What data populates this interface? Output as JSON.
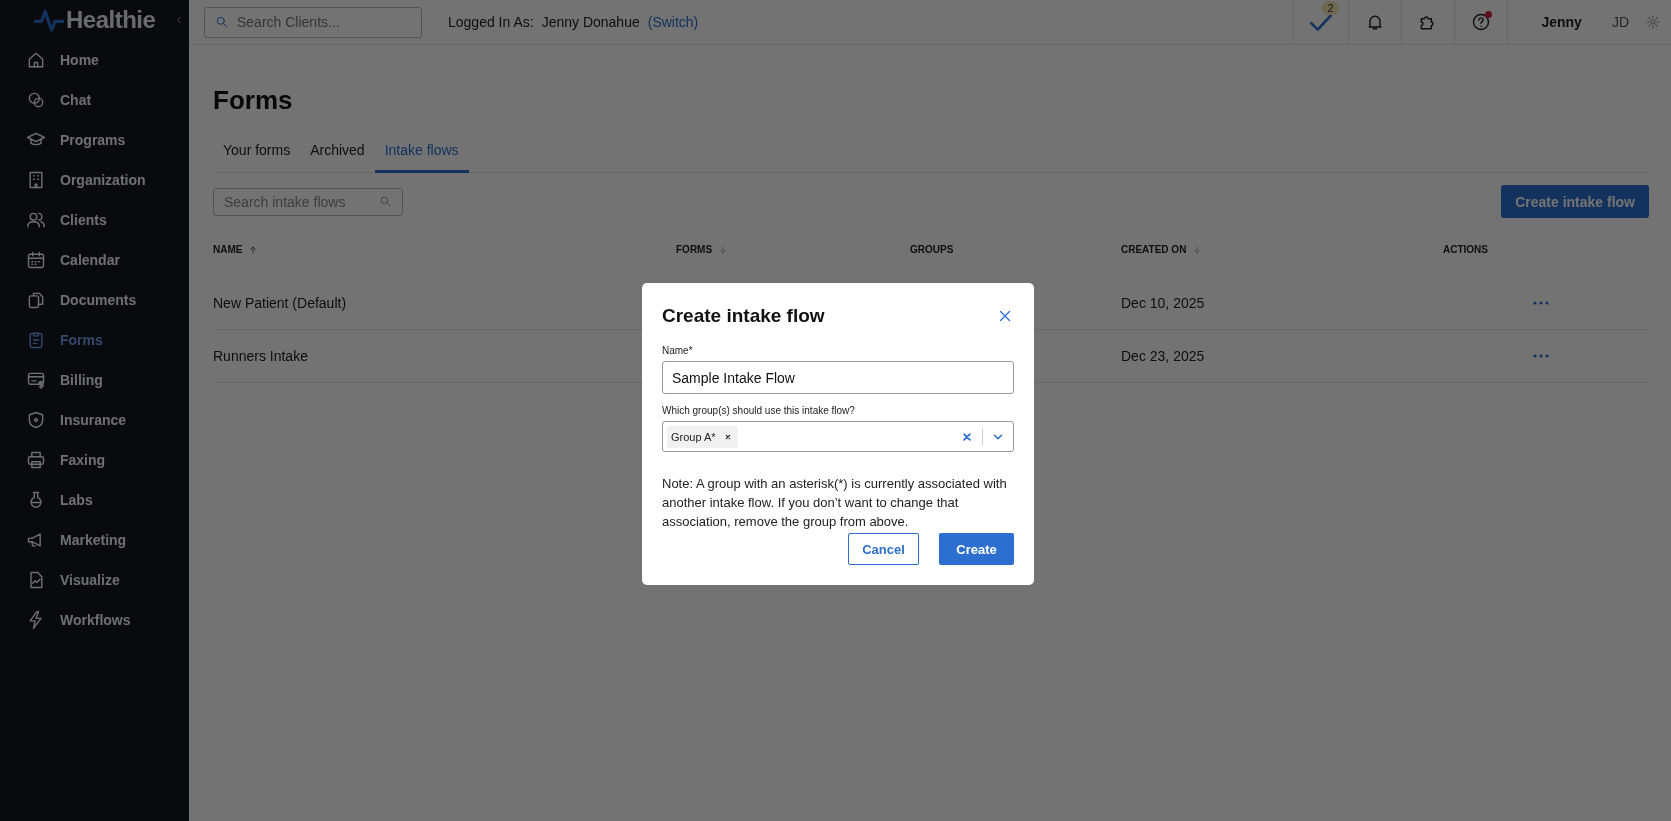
{
  "sidebar": {
    "logo": "Healthie",
    "items": [
      {
        "label": "Home",
        "selected": false
      },
      {
        "label": "Chat",
        "selected": false
      },
      {
        "label": "Programs",
        "selected": false
      },
      {
        "label": "Organization",
        "selected": false
      },
      {
        "label": "Clients",
        "selected": false
      },
      {
        "label": "Calendar",
        "selected": false
      },
      {
        "label": "Documents",
        "selected": false
      },
      {
        "label": "Forms",
        "selected": true
      },
      {
        "label": "Billing",
        "selected": false
      },
      {
        "label": "Insurance",
        "selected": false
      },
      {
        "label": "Faxing",
        "selected": false
      },
      {
        "label": "Labs",
        "selected": false
      },
      {
        "label": "Marketing",
        "selected": false
      },
      {
        "label": "Visualize",
        "selected": false
      },
      {
        "label": "Workflows",
        "selected": false
      }
    ]
  },
  "header": {
    "search_placeholder": "Search Clients...",
    "logged_in_label": "Logged In As:",
    "user_name": "Jenny Donahue",
    "switch_link": "(Switch)",
    "tasks_badge": "2",
    "help_alert": true,
    "user_first_name": "Jenny",
    "initials": "JD"
  },
  "page": {
    "title": "Forms",
    "tabs": [
      {
        "label": "Your forms",
        "selected": false
      },
      {
        "label": "Archived",
        "selected": false
      },
      {
        "label": "Intake flows",
        "selected": true
      }
    ],
    "search_placeholder": "Search intake flows",
    "create_button": "Create intake flow",
    "table": {
      "columns": [
        {
          "label": "NAME",
          "kind": "sorted"
        },
        {
          "label": "FORMS",
          "kind": "sortable"
        },
        {
          "label": "GROUPS",
          "kind": "plain"
        },
        {
          "label": "CREATED ON",
          "kind": "sortable"
        },
        {
          "label": "ACTIONS",
          "kind": "plain"
        }
      ],
      "rows": [
        {
          "name": "New Patient (Default)",
          "created_on": "Dec 10, 2025"
        },
        {
          "name": "Runners Intake",
          "created_on": "Dec 23, 2025"
        }
      ]
    }
  },
  "modal": {
    "title": "Create intake flow",
    "name_label": "Name*",
    "name_value": "Sample Intake Flow",
    "groups_label": "Which group(s) should use this intake flow?",
    "chips": [
      {
        "label": "Group A*"
      }
    ],
    "note": "Note: A group with an asterisk(*) is currently associated with another intake flow. If you don’t want to change that association, remove the group from above.",
    "cancel_button": "Cancel",
    "create_button": "Create"
  }
}
